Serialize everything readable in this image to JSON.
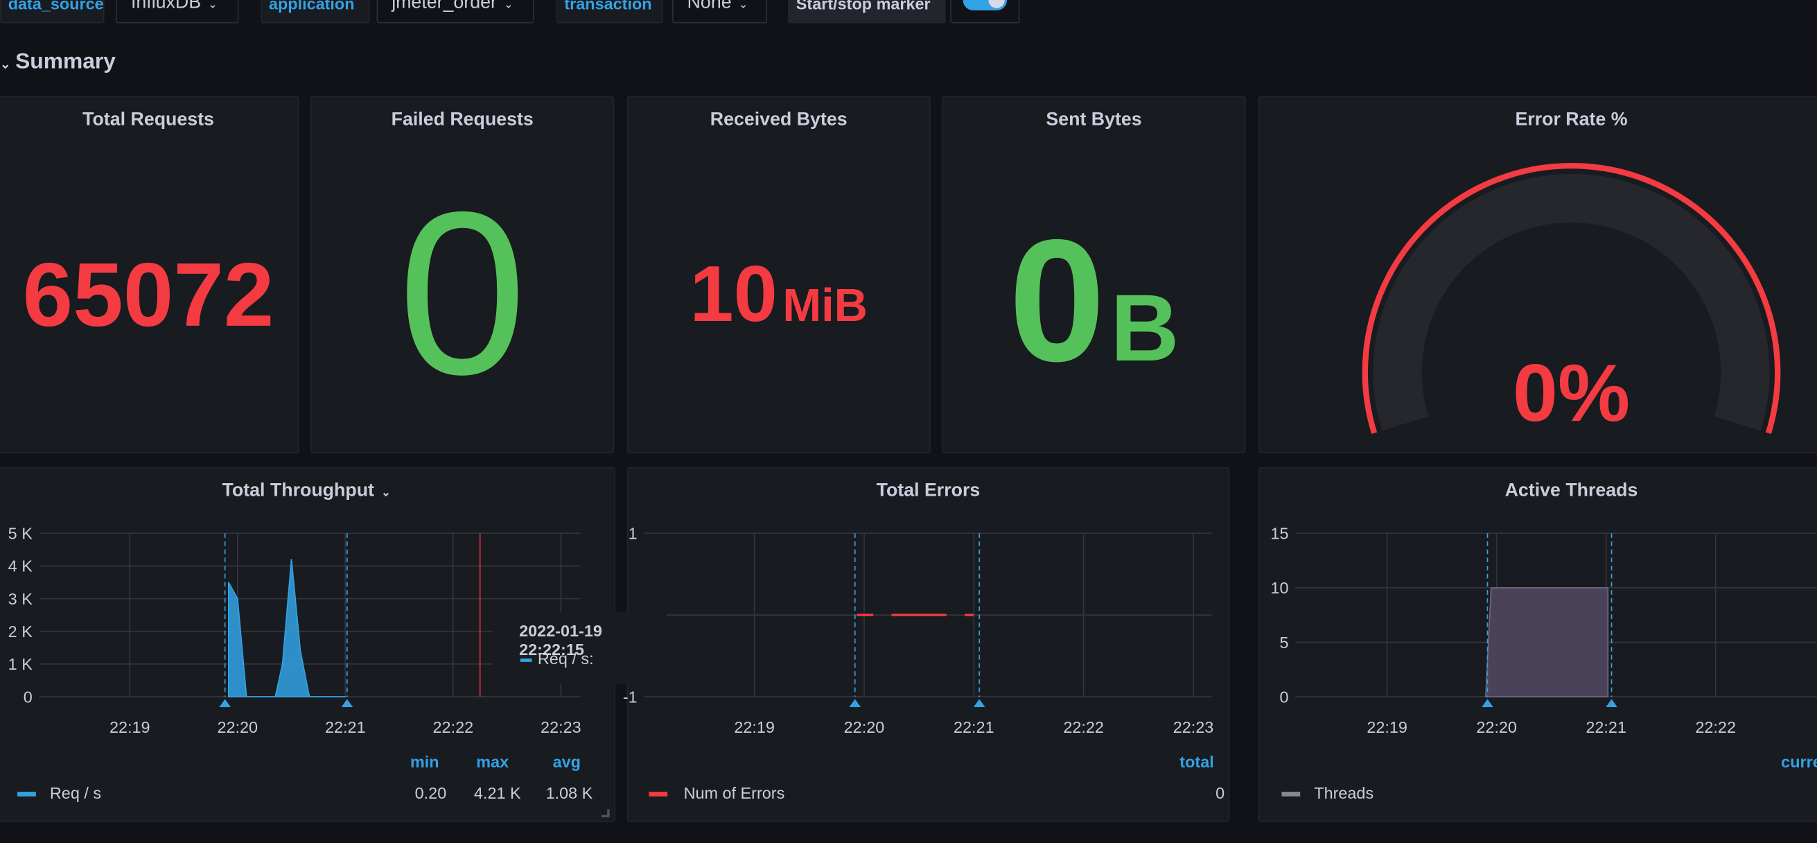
{
  "variables": [
    {
      "label": "data_source",
      "value": "InfluxDB"
    },
    {
      "label": "application",
      "value": "jmeter_order"
    },
    {
      "label": "transaction",
      "value": "None"
    }
  ],
  "marker": {
    "label": "Start/stop marker",
    "enabled": true
  },
  "row": {
    "title": "Summary"
  },
  "stats": {
    "total_requests": {
      "title": "Total Requests",
      "value": "65072"
    },
    "failed_requests": {
      "title": "Failed Requests",
      "value": "0"
    },
    "received_bytes": {
      "title": "Received Bytes",
      "value": "10",
      "unit": "MiB"
    },
    "sent_bytes": {
      "title": "Sent Bytes",
      "value": "0",
      "unit": "B"
    },
    "error_rate": {
      "title": "Error Rate %",
      "value": "0%",
      "gauge_fraction": 0
    }
  },
  "colors": {
    "red": "#f43b42",
    "green": "#55c15a",
    "blue": "#33a2e5",
    "threads": "#4a4259"
  },
  "chart_data": [
    {
      "type": "area",
      "title": "Total Throughput",
      "x_ticks": [
        "22:19",
        "22:20",
        "22:21",
        "22:22",
        "22:23"
      ],
      "y_ticks": [
        "0",
        "1 K",
        "2 K",
        "3 K",
        "4 K",
        "5 K"
      ],
      "ylim": [
        0,
        5000
      ],
      "series": [
        {
          "name": "Req / s",
          "color": "#33a2e5",
          "x": [
            "22:19:55",
            "22:20:00",
            "22:20:05",
            "22:20:16",
            "22:20:21",
            "22:20:25",
            "22:20:30",
            "22:20:35",
            "22:20:40",
            "22:20:46",
            "22:20:55",
            "22:21:00"
          ],
          "values": [
            3500,
            3000,
            0,
            0,
            0,
            1000,
            4210,
            1400,
            0,
            0,
            0.2,
            0.2
          ]
        }
      ],
      "annotations": [
        "22:19:53",
        "22:21:01"
      ],
      "cursor": "22:22:15",
      "legend": {
        "headers": [
          "min",
          "max",
          "avg"
        ],
        "values": [
          "0.20",
          "4.21 K",
          "1.08 K"
        ]
      },
      "tooltip": {
        "time": "2022-01-19 22:22:15",
        "series": "Req / s:"
      }
    },
    {
      "type": "line",
      "title": "Total Errors",
      "x_ticks": [
        "22:19",
        "22:20",
        "22:21",
        "22:22",
        "22:23"
      ],
      "y_ticks": [
        "-1",
        "1"
      ],
      "ylim": [
        -1,
        1
      ],
      "series": [
        {
          "name": "Num of Errors",
          "color": "#f43b42",
          "segments": [
            [
              "22:19:56",
              "22:20:05"
            ],
            [
              "22:20:15",
              "22:20:45"
            ],
            [
              "22:20:55",
              "22:21:00"
            ]
          ],
          "value": 0
        }
      ],
      "annotations": [
        "22:19:55",
        "22:21:03"
      ],
      "legend": {
        "headers": [
          "total"
        ],
        "values": [
          "0"
        ]
      }
    },
    {
      "type": "area",
      "title": "Active Threads",
      "x_ticks": [
        "22:19",
        "22:20",
        "22:21",
        "22:22",
        "22:23"
      ],
      "y_ticks": [
        "0",
        "5",
        "10",
        "15"
      ],
      "ylim": [
        0,
        15
      ],
      "series": [
        {
          "name": "Threads",
          "color": "#4a4259",
          "x": [
            "22:19:54",
            "22:19:57",
            "22:21:01",
            "22:21:01"
          ],
          "values": [
            0,
            10,
            10,
            0
          ]
        }
      ],
      "annotations": [
        "22:19:55",
        "22:21:03"
      ],
      "legend": {
        "headers": [
          "current"
        ]
      }
    }
  ]
}
